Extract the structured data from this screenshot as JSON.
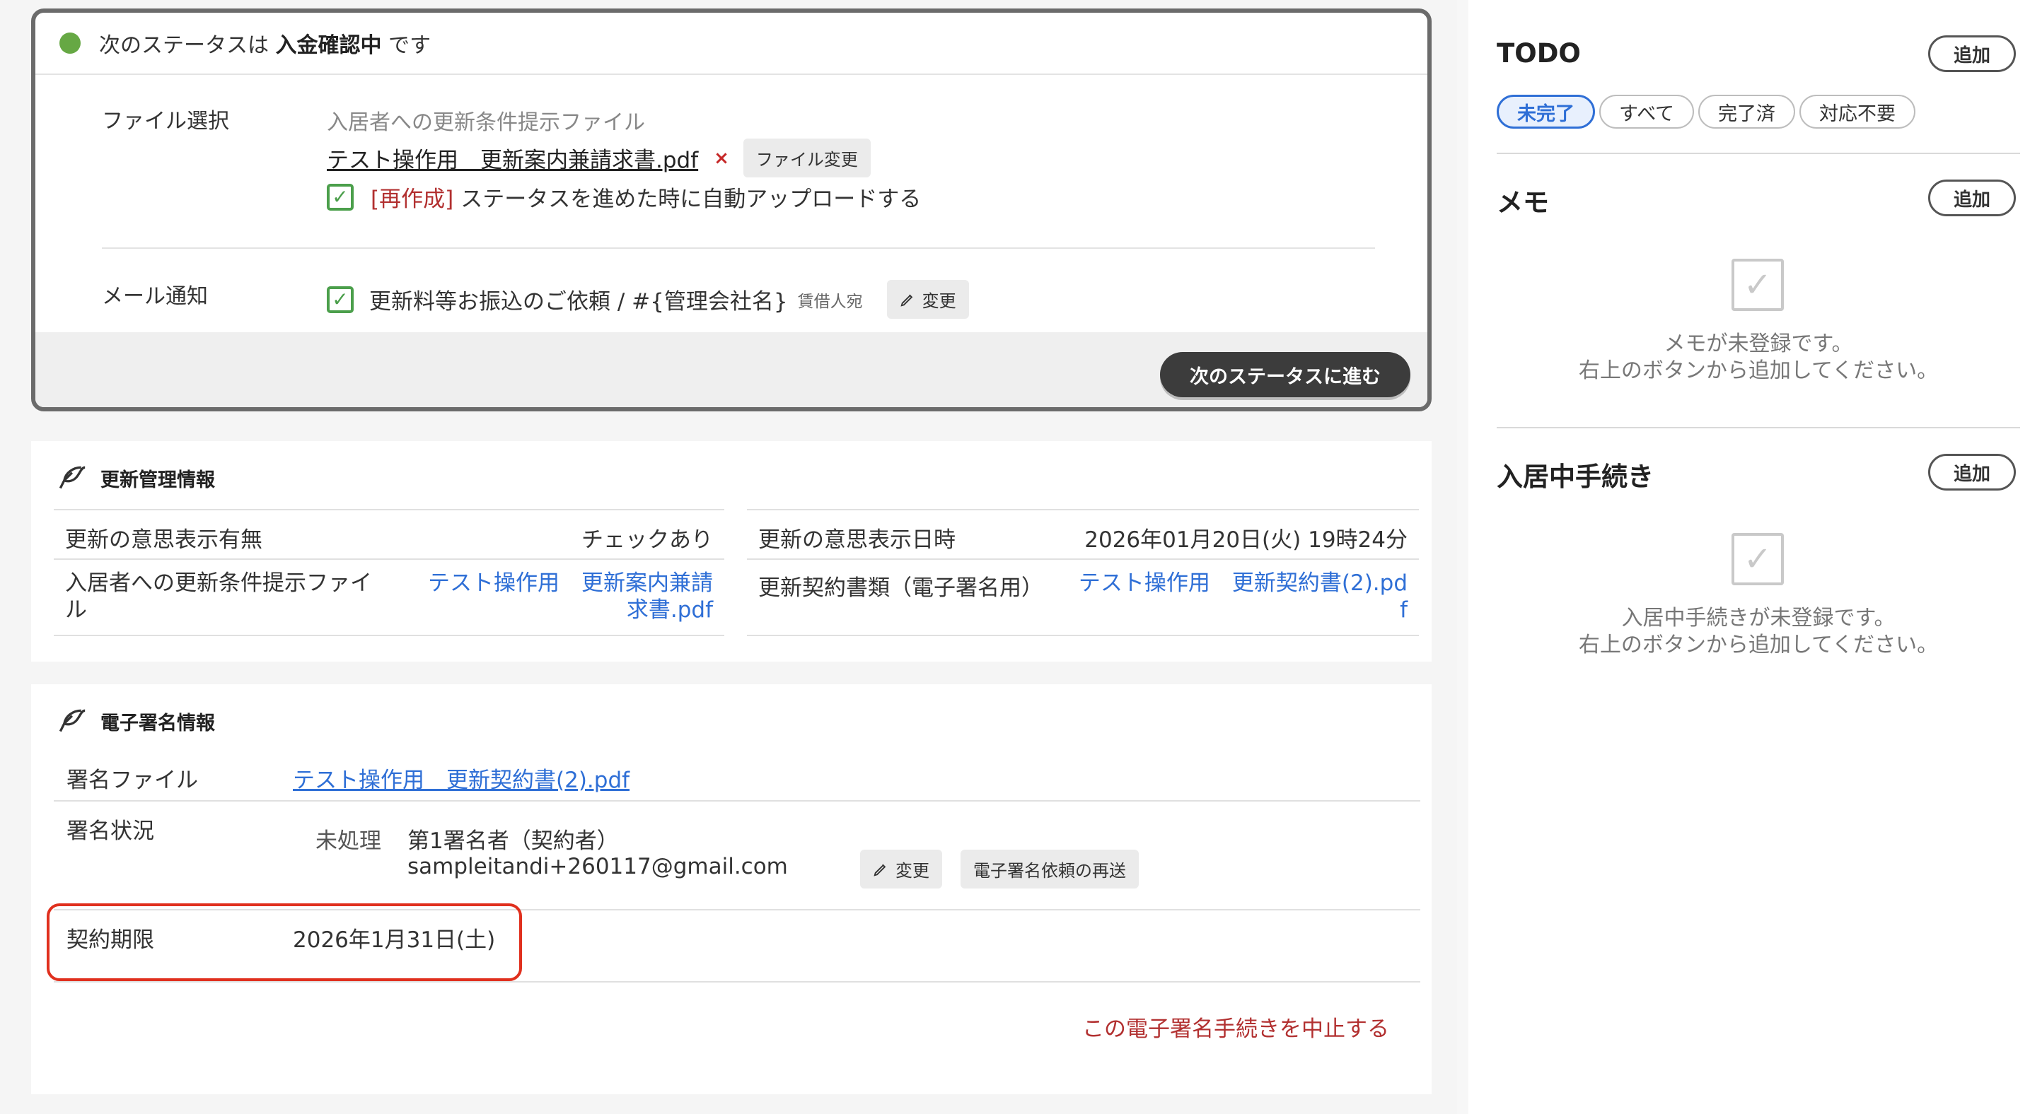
{
  "status": {
    "prefix": "次のステータスは",
    "name": "入金確認中",
    "suffix": "です",
    "file_select_label": "ファイル選択",
    "file_caption": "入居者への更新条件提示ファイル",
    "file_name": "テスト操作用　更新案内兼請求書.pdf",
    "remove_icon": "×",
    "file_change_label": "ファイル変更",
    "auto_tag": "[再作成]",
    "auto_text": "ステータスを進めた時に自動アップロードする",
    "mail_label": "メール通知",
    "mail_text": "更新料等お振込のご依頼 / #{管理会社名}",
    "mail_sub": "賃借人宛",
    "mail_change_label": "変更",
    "next_button": "次のステータスに進む"
  },
  "renewal": {
    "title": "更新管理情報",
    "intent_label": "更新の意思表示有無",
    "intent_value": "チェックあり",
    "intent_date_label": "更新の意思表示日時",
    "intent_date_value": "2026年01月20日(火) 19時24分",
    "file_label_1": "入居者への更新条件提示ファイ",
    "file_label_2": "ル",
    "file_value_1": "テスト操作用　更新案内兼請",
    "file_value_2": "求書.pdf",
    "contract_label": "更新契約書類（電子署名用）",
    "contract_value_1": "テスト操作用　更新契約書(2).pd",
    "contract_value_2": "f"
  },
  "esign": {
    "title": "電子署名情報",
    "file_label": "署名ファイル",
    "file_value": "テスト操作用　更新契約書(2).pdf",
    "status_label": "署名状況",
    "state": "未処理",
    "signer": "第1署名者（契約者）",
    "email": "sampleitandi+260117@gmail.com",
    "change_label": "変更",
    "resend_label": "電子署名依頼の再送",
    "deadline_label": "契約期限",
    "deadline_value": "2026年1月31日(土)",
    "cancel_link": "この電子署名手続きを中止する"
  },
  "sidebar": {
    "todo_title": "TODO",
    "todo_add": "追加",
    "filters": [
      "未完了",
      "すべて",
      "完了済",
      "対応不要"
    ],
    "memo_title": "メモ",
    "memo_add": "追加",
    "memo_empty_1": "メモが未登録です。",
    "memo_empty_2": "右上のボタンから追加してください。",
    "proc_title": "入居中手続き",
    "proc_add": "追加",
    "proc_empty_1": "入居中手続きが未登録です。",
    "proc_empty_2": "右上のボタンから追加してください。"
  },
  "colors": {
    "accent": "#2f6fd6",
    "ok": "#66a844",
    "danger": "#e0301e",
    "dark": "#3c3c3c"
  }
}
